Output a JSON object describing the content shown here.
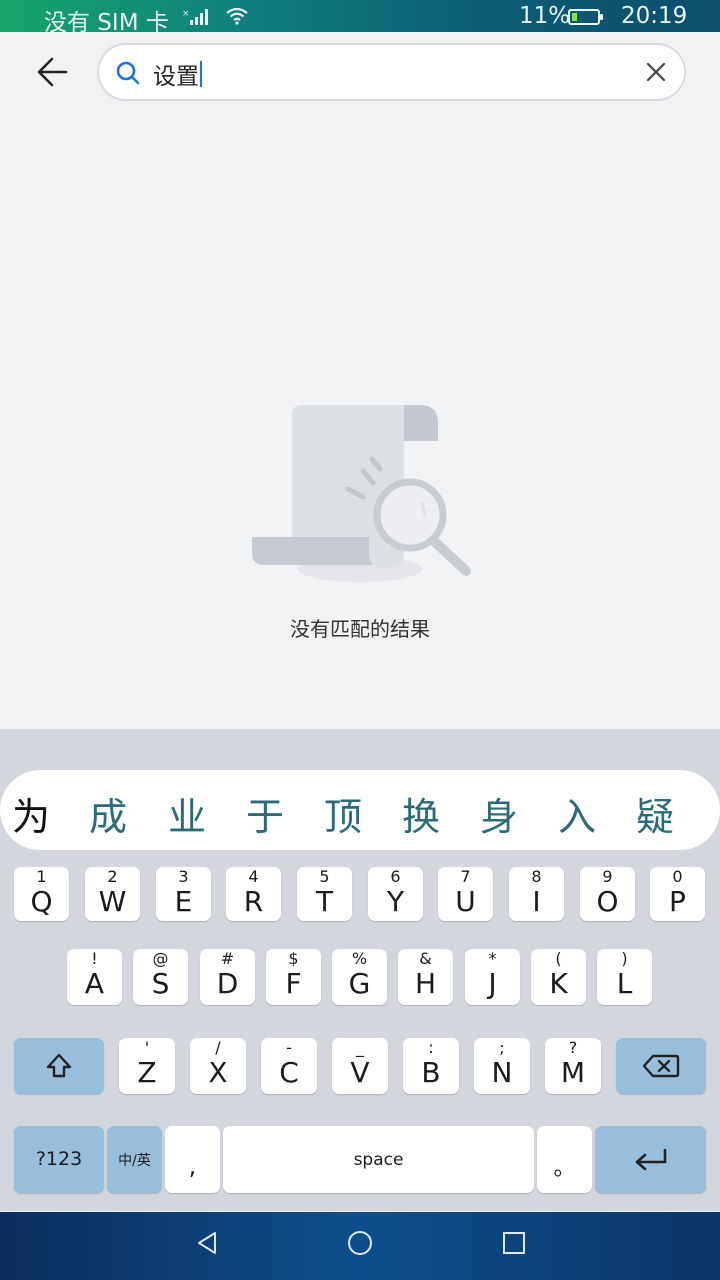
{
  "status_bar": {
    "carrier": "没有 SIM 卡",
    "battery": "11%",
    "time": "20:19"
  },
  "search": {
    "query": "设置"
  },
  "empty_state": {
    "message": "没有匹配的结果"
  },
  "keyboard": {
    "candidates": [
      "为",
      "成",
      "业",
      "于",
      "顶",
      "换",
      "身",
      "入",
      "疑"
    ],
    "row1": [
      {
        "main": "Q",
        "sub": "1"
      },
      {
        "main": "W",
        "sub": "2"
      },
      {
        "main": "E",
        "sub": "3"
      },
      {
        "main": "R",
        "sub": "4"
      },
      {
        "main": "T",
        "sub": "5"
      },
      {
        "main": "Y",
        "sub": "6"
      },
      {
        "main": "U",
        "sub": "7"
      },
      {
        "main": "I",
        "sub": "8"
      },
      {
        "main": "O",
        "sub": "9"
      },
      {
        "main": "P",
        "sub": "0"
      }
    ],
    "row2": [
      {
        "main": "A",
        "sub": "!"
      },
      {
        "main": "S",
        "sub": "@"
      },
      {
        "main": "D",
        "sub": "#"
      },
      {
        "main": "F",
        "sub": "$"
      },
      {
        "main": "G",
        "sub": "%"
      },
      {
        "main": "H",
        "sub": "&"
      },
      {
        "main": "J",
        "sub": "*"
      },
      {
        "main": "K",
        "sub": "("
      },
      {
        "main": "L",
        "sub": ")"
      }
    ],
    "row3": [
      {
        "main": "Z",
        "sub": "'"
      },
      {
        "main": "X",
        "sub": "/"
      },
      {
        "main": "C",
        "sub": "-"
      },
      {
        "main": "V",
        "sub": "_"
      },
      {
        "main": "B",
        "sub": ":"
      },
      {
        "main": "N",
        "sub": ";"
      },
      {
        "main": "M",
        "sub": "?"
      }
    ],
    "symbols_label": "?123",
    "lang_label": "中/英",
    "comma_label": ",",
    "space_label": "space",
    "period_label": "。"
  },
  "colors": {
    "accent": "#1a73e8",
    "candidate": "#2a6b78",
    "function_key": "#97bfdb"
  }
}
